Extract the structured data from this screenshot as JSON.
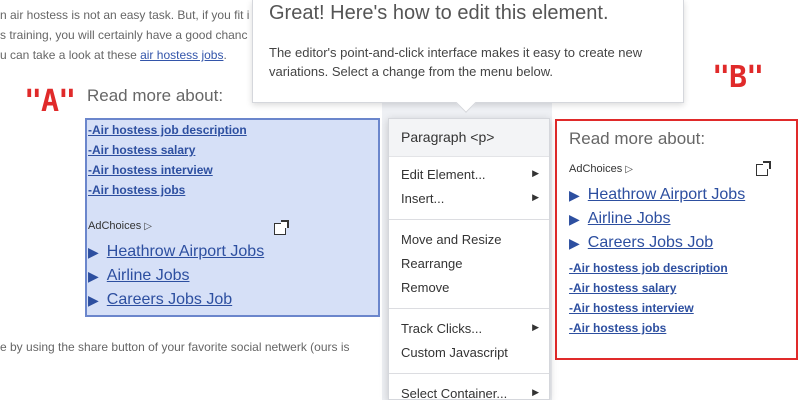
{
  "article": {
    "line1_text": "n air hostess is not an easy task. But, if you fit i",
    "line2_text": "s training, you will certainly have a good chanc",
    "line3_prefix": "u can take a look at these ",
    "line3_link": "air hostess jobs",
    "line3_suffix": ".",
    "line4_text": "e by using the share button of your favorite social netwerk (ours is"
  },
  "labels": {
    "a": "\"A\"",
    "b": "\"B\""
  },
  "variation_a": {
    "heading": "Read more about:",
    "small_links": [
      "Air hostess job description",
      "Air hostess salary",
      "Air hostess interview",
      "Air hostess jobs"
    ],
    "dash": "-",
    "adchoices": "AdChoices",
    "large_links": [
      "Heathrow Airport Jobs",
      "Airline Jobs",
      "Careers Jobs Job"
    ],
    "triangle": "▶"
  },
  "variation_b": {
    "heading": "Read more about:",
    "adchoices": "AdChoices",
    "large_links": [
      "Heathrow Airport Jobs",
      "Airline Jobs",
      "Careers Jobs Job"
    ],
    "small_links": [
      "Air hostess job description",
      "Air hostess salary",
      "Air hostess interview",
      "Air hostess jobs"
    ],
    "dash": "-",
    "triangle": "▶"
  },
  "tooltip": {
    "title": "Great! Here's how to edit this element.",
    "body": "The editor's point-and-click interface makes it easy to create new variations. Select a change from the menu below."
  },
  "menu": {
    "header": "Paragraph <p>",
    "submenu_arrow": "▶",
    "items": {
      "edit_element": "Edit Element...",
      "insert": "Insert...",
      "move_resize": "Move and Resize",
      "rearrange": "Rearrange",
      "remove": "Remove",
      "track_clicks": "Track Clicks...",
      "custom_js": "Custom Javascript",
      "select_container": "Select Container..."
    }
  },
  "colors": {
    "label_red": "#e02a2a",
    "box_a_fill": "#d6e0f7",
    "box_a_border": "#6b86cc",
    "link_blue": "#2d4fa0"
  }
}
